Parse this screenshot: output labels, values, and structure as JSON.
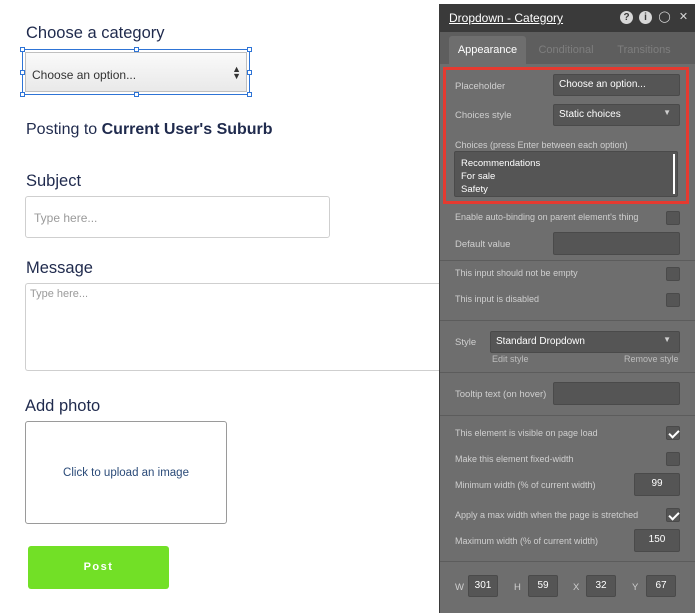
{
  "canvas": {
    "category_heading": "Choose a category",
    "dropdown_placeholder": "Choose an option...",
    "posting_prefix": "Posting to",
    "posting_location": "Current User's Suburb",
    "subject_heading": "Subject",
    "subject_placeholder": "Type here...",
    "message_heading": "Message",
    "message_placeholder": "Type here...",
    "photo_heading": "Add photo",
    "upload_text": "Click to upload an image",
    "post_button": "Post"
  },
  "panel": {
    "title": "Dropdown - Category",
    "tabs": [
      "Appearance",
      "Conditional",
      "Transitions"
    ],
    "placeholder_label": "Placeholder",
    "placeholder_value": "Choose an option...",
    "choices_style_label": "Choices style",
    "choices_style_value": "Static choices",
    "choices_label": "Choices (press Enter between each option)",
    "choices": [
      "Recommendations",
      "For sale",
      "Safety"
    ],
    "auto_binding_label": "Enable auto-binding on parent element's thing",
    "default_value_label": "Default value",
    "not_empty_label": "This input should not be empty",
    "disabled_label": "This input is disabled",
    "style_label": "Style",
    "style_value": "Standard Dropdown",
    "edit_style": "Edit style",
    "remove_style": "Remove style",
    "tooltip_label": "Tooltip text (on hover)",
    "visible_label": "This element is visible on page load",
    "visible_checked": true,
    "fixed_width_label": "Make this element fixed-width",
    "fixed_width_checked": false,
    "min_width_label": "Minimum width (% of current width)",
    "min_width_value": "99",
    "max_width_apply_label": "Apply a max width when the page is stretched",
    "max_width_apply_checked": true,
    "max_width_label": "Maximum width (% of current width)",
    "max_width_value": "150",
    "dims": {
      "w_label": "W",
      "w_value": "301",
      "h_label": "H",
      "h_value": "59",
      "x_label": "X",
      "x_value": "32",
      "y_label": "Y",
      "y_value": "67"
    }
  },
  "colors": {
    "accent_blue": "#2e74d6",
    "post_green": "#72e026",
    "highlight_red": "#e53a30",
    "panel_bg": "#6e6e6e"
  }
}
